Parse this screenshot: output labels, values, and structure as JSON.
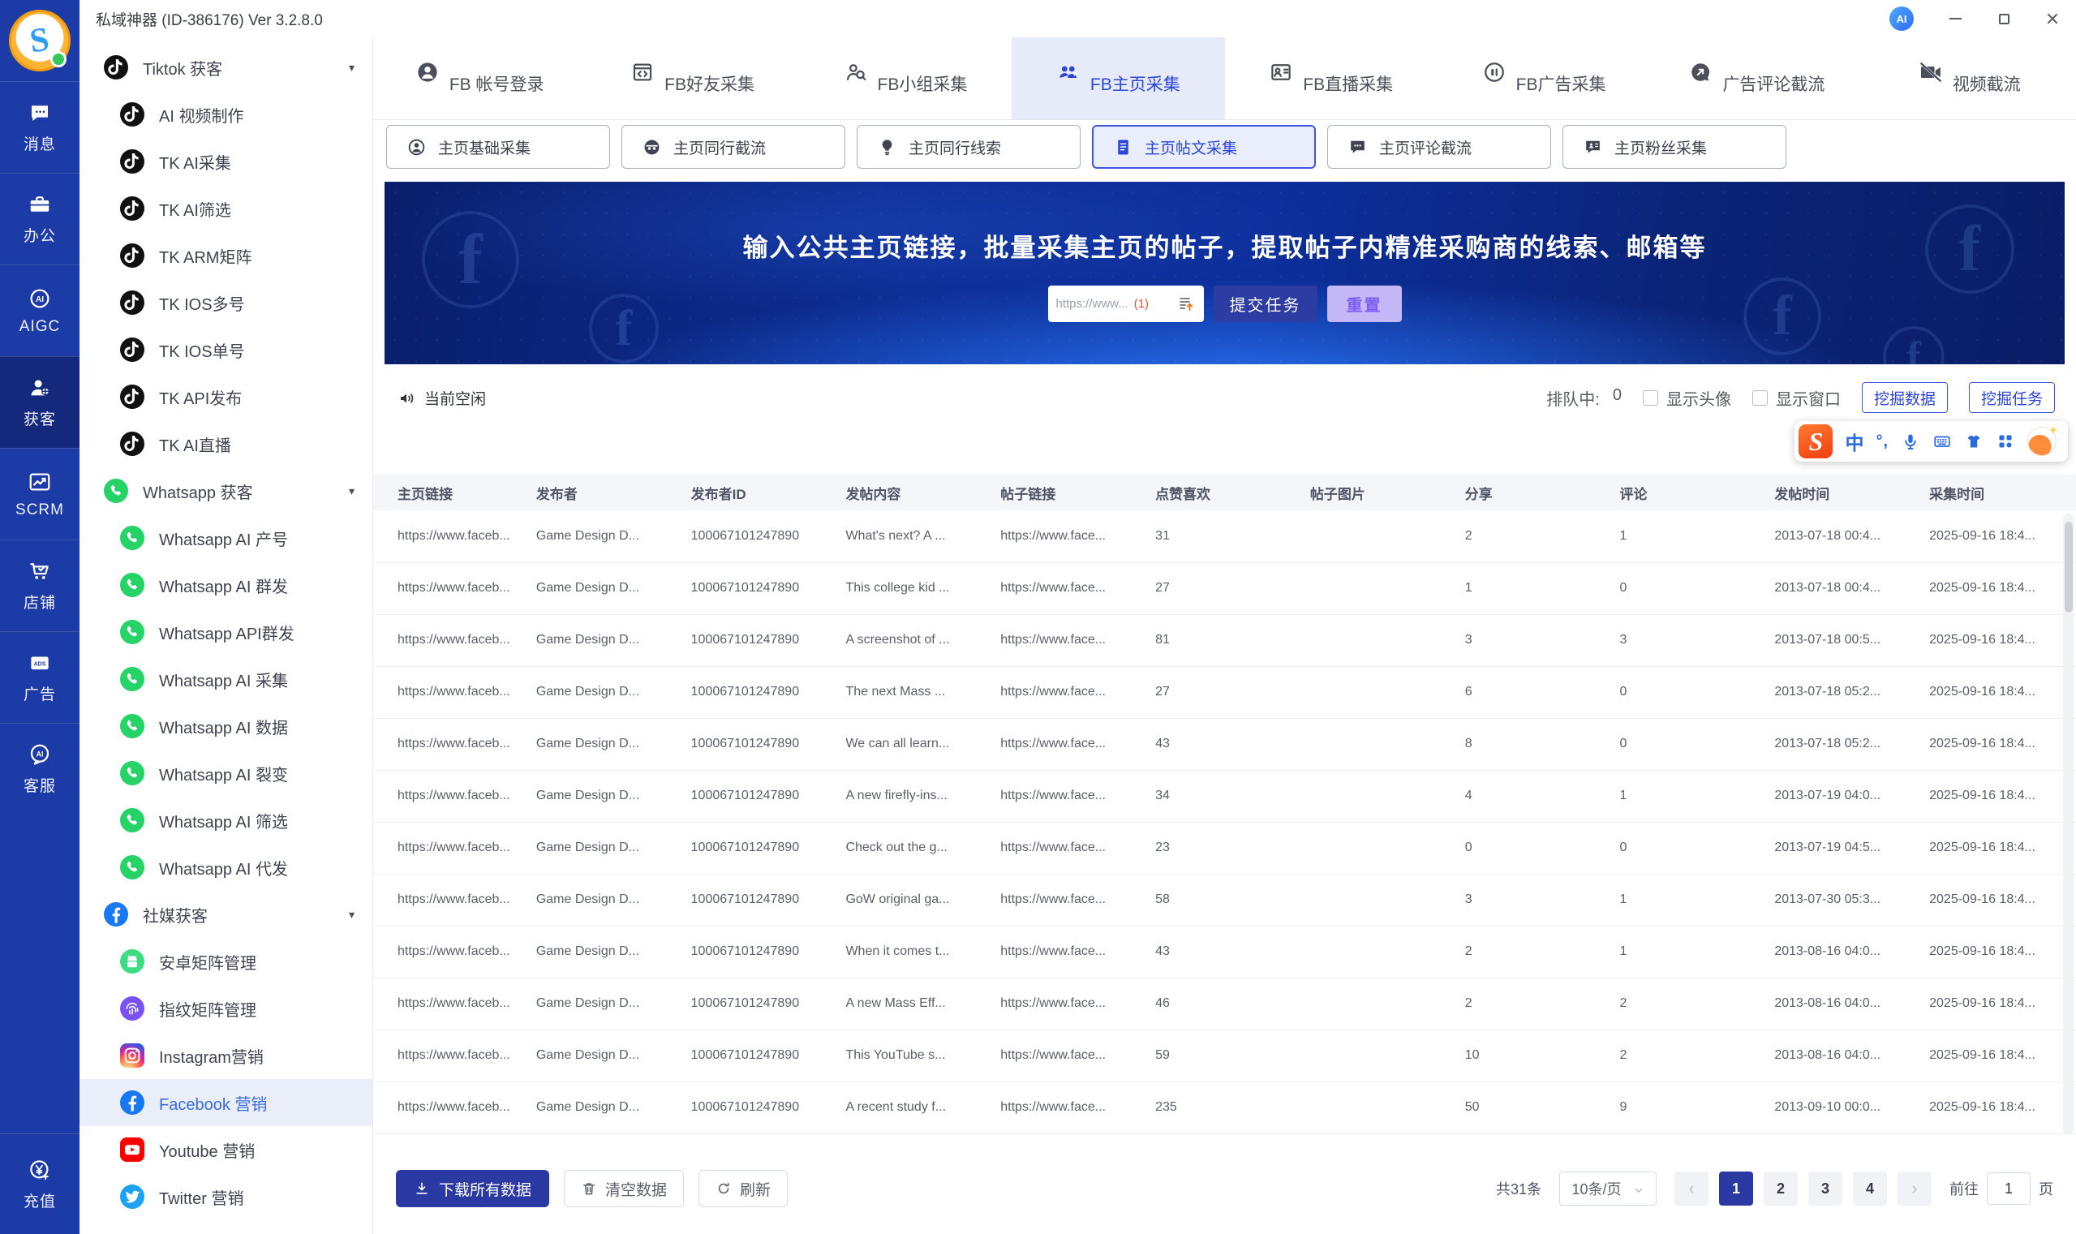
{
  "theme": {
    "primary": "#2c45d6",
    "primary_dark": "#2b3aa3",
    "rail_bg": "#1d3ba6",
    "rail_selected": "#15297c",
    "accent_red": "#f4502e",
    "reset_bg": "#c3b7f6",
    "reset_text": "#7e5ef2",
    "tab_selected_bg": "#e7eaf8",
    "brand": {
      "tiktok": "#111111",
      "whatsapp": "#25d366",
      "facebook": "#1877f2",
      "android": "#3ddc84",
      "fingerprint": "#7a52f4",
      "youtube": "#ff0000",
      "twitter": "#1da1f2",
      "sogou": "#fc5531",
      "instagram": "radial-gradient(circle at 30% 110%, #fdf497 0%, #fd5949 45%, #d6249f 60%, #285aeb 90%)"
    }
  },
  "window": {
    "title": "私域神器 (ID-386176) Ver 3.2.8.0",
    "ai_badge": "AI"
  },
  "rail": {
    "items": [
      {
        "name": "messages",
        "icon": "message-icon",
        "label": "消息",
        "selected": false
      },
      {
        "name": "office",
        "icon": "office-icon",
        "label": "办公",
        "selected": false
      },
      {
        "name": "aigc",
        "icon": "aigc-icon",
        "label": "AIGC",
        "selected": false
      },
      {
        "name": "acquire",
        "icon": "acquire-icon",
        "label": "获客",
        "selected": true
      },
      {
        "name": "scrm",
        "icon": "scrm-icon",
        "label": "SCRM",
        "selected": false
      },
      {
        "name": "shop",
        "icon": "shop-icon",
        "label": "店铺",
        "selected": false
      },
      {
        "name": "ads",
        "icon": "ads-icon",
        "label": "广告",
        "selected": false
      },
      {
        "name": "service",
        "icon": "service-icon",
        "label": "客服",
        "selected": false
      }
    ],
    "bottom": {
      "name": "recharge",
      "icon": "recharge-icon",
      "label": "充值"
    }
  },
  "sidebar": {
    "items": [
      {
        "name": "tiktok-group",
        "type": "group",
        "icon": "tiktok-icon",
        "label": "Tiktok 获客"
      },
      {
        "name": "ai-video",
        "type": "item",
        "icon": "tiktok-icon",
        "label": "AI 视频制作"
      },
      {
        "name": "tk-ai-collect",
        "type": "item",
        "icon": "tiktok-icon",
        "label": "TK AI采集"
      },
      {
        "name": "tk-ai-filter",
        "type": "item",
        "icon": "tiktok-icon",
        "label": "TK AI筛选"
      },
      {
        "name": "tk-arm-matrix",
        "type": "item",
        "icon": "tiktok-icon",
        "label": "TK ARM矩阵"
      },
      {
        "name": "tk-ios-multi",
        "type": "item",
        "icon": "tiktok-icon",
        "label": "TK IOS多号"
      },
      {
        "name": "tk-ios-single",
        "type": "item",
        "icon": "tiktok-icon",
        "label": "TK IOS单号"
      },
      {
        "name": "tk-api-publish",
        "type": "item",
        "icon": "tiktok-icon",
        "label": "TK API发布"
      },
      {
        "name": "tk-ai-live",
        "type": "item",
        "icon": "tiktok-icon",
        "label": "TK AI直播"
      },
      {
        "name": "whatsapp-group",
        "type": "group",
        "icon": "whatsapp-icon",
        "label": "Whatsapp 获客"
      },
      {
        "name": "wa-ai-account",
        "type": "item",
        "icon": "whatsapp-icon",
        "label": "Whatsapp AI 产号"
      },
      {
        "name": "wa-ai-mass",
        "type": "item",
        "icon": "whatsapp-icon",
        "label": "Whatsapp AI 群发"
      },
      {
        "name": "wa-api-mass",
        "type": "item",
        "icon": "whatsapp-icon",
        "label": "Whatsapp API群发"
      },
      {
        "name": "wa-ai-collect",
        "type": "item",
        "icon": "whatsapp-icon",
        "label": "Whatsapp AI 采集"
      },
      {
        "name": "wa-ai-data",
        "type": "item",
        "icon": "whatsapp-icon",
        "label": "Whatsapp AI 数据"
      },
      {
        "name": "wa-ai-fission",
        "type": "item",
        "icon": "whatsapp-icon",
        "label": "Whatsapp AI 裂变"
      },
      {
        "name": "wa-ai-filter",
        "type": "item",
        "icon": "whatsapp-icon",
        "label": "Whatsapp AI 筛选"
      },
      {
        "name": "wa-ai-proxy",
        "type": "item",
        "icon": "whatsapp-icon",
        "label": "Whatsapp AI 代发"
      },
      {
        "name": "social-group",
        "type": "group",
        "icon": "facebook-icon",
        "label": "社媒获客"
      },
      {
        "name": "android-matrix",
        "type": "item",
        "icon": "android-icon",
        "label": "安卓矩阵管理"
      },
      {
        "name": "fingerprint-matrix",
        "type": "item",
        "icon": "fingerprint-icon",
        "label": "指纹矩阵管理"
      },
      {
        "name": "instagram-marketing",
        "type": "item",
        "icon": "instagram-icon",
        "label": "Instagram营销"
      },
      {
        "name": "facebook-marketing",
        "type": "item",
        "icon": "facebook-icon",
        "label": "Facebook 营销",
        "selected": true
      },
      {
        "name": "youtube-marketing",
        "type": "item",
        "icon": "youtube-icon",
        "label": "Youtube 营销"
      },
      {
        "name": "twitter-marketing",
        "type": "item",
        "icon": "twitter-icon",
        "label": "Twitter 营销"
      }
    ]
  },
  "tabs": [
    {
      "name": "fb-login",
      "icon": "account-icon",
      "label": "FB 帐号登录"
    },
    {
      "name": "fb-friends",
      "icon": "friends-icon",
      "label": "FB好友采集"
    },
    {
      "name": "fb-groups",
      "icon": "group-search-icon",
      "label": "FB小组采集"
    },
    {
      "name": "fb-pages",
      "icon": "page-collect-icon",
      "label": "FB主页采集",
      "selected": true
    },
    {
      "name": "fb-live",
      "icon": "live-icon",
      "label": "FB直播采集"
    },
    {
      "name": "fb-ads",
      "icon": "fb-ads-icon",
      "label": "FB广告采集"
    },
    {
      "name": "ad-comment",
      "icon": "ad-comment-icon",
      "label": "广告评论截流"
    },
    {
      "name": "video-intercept",
      "icon": "video-icon",
      "label": "视频截流"
    }
  ],
  "subtabs": [
    {
      "name": "page-basic",
      "icon": "profile-icon",
      "label": "主页基础采集"
    },
    {
      "name": "peer-intercept",
      "icon": "peer-icon",
      "label": "主页同行截流"
    },
    {
      "name": "peer-leads",
      "icon": "bulb-icon",
      "label": "主页同行线索"
    },
    {
      "name": "page-posts",
      "icon": "post-doc-icon",
      "label": "主页帖文采集",
      "selected": true
    },
    {
      "name": "comment-intercept",
      "icon": "comment-icon",
      "label": "主页评论截流"
    },
    {
      "name": "fans-collect",
      "icon": "fans-icon",
      "label": "主页粉丝采集"
    }
  ],
  "banner": {
    "title": "输入公共主页链接，批量采集主页的帖子，提取帖子内精准采购商的线索、邮箱等",
    "input_placeholder": "https://www...",
    "input_count": "(1)",
    "submit_label": "提交任务",
    "reset_label": "重置"
  },
  "statusbar": {
    "idle_label": "当前空闲",
    "queue_label": "排队中:",
    "queue_value": "0",
    "show_avatar": "显示头像",
    "show_window": "显示窗口",
    "mine_data": "挖掘数据",
    "mine_task": "挖掘任务"
  },
  "ime": {
    "logo": "S",
    "mode": "中",
    "punct": "°,"
  },
  "table": {
    "columns": [
      {
        "key": "link",
        "label": "主页链接"
      },
      {
        "key": "publisher",
        "label": "发布者"
      },
      {
        "key": "publisher_id",
        "label": "发布者ID"
      },
      {
        "key": "content",
        "label": "发帖内容"
      },
      {
        "key": "post_link",
        "label": "帖子链接"
      },
      {
        "key": "likes",
        "label": "点赞喜欢"
      },
      {
        "key": "image",
        "label": "帖子图片"
      },
      {
        "key": "shares",
        "label": "分享"
      },
      {
        "key": "comments",
        "label": "评论"
      },
      {
        "key": "post_time",
        "label": "发帖时间"
      },
      {
        "key": "collect_time",
        "label": "采集时间"
      }
    ],
    "rows": [
      {
        "link": "https://www.faceb...",
        "publisher": "Game Design D...",
        "publisher_id": "100067101247890",
        "content": "What's next? A ...",
        "post_link": "https://www.face...",
        "likes": "31",
        "image": "",
        "shares": "2",
        "comments": "1",
        "post_time": "2013-07-18 00:4...",
        "collect_time": "2025-09-16 18:4..."
      },
      {
        "link": "https://www.faceb...",
        "publisher": "Game Design D...",
        "publisher_id": "100067101247890",
        "content": "This college kid ...",
        "post_link": "https://www.face...",
        "likes": "27",
        "image": "",
        "shares": "1",
        "comments": "0",
        "post_time": "2013-07-18 00:4...",
        "collect_time": "2025-09-16 18:4..."
      },
      {
        "link": "https://www.faceb...",
        "publisher": "Game Design D...",
        "publisher_id": "100067101247890",
        "content": "A screenshot of ...",
        "post_link": "https://www.face...",
        "likes": "81",
        "image": "",
        "shares": "3",
        "comments": "3",
        "post_time": "2013-07-18 00:5...",
        "collect_time": "2025-09-16 18:4..."
      },
      {
        "link": "https://www.faceb...",
        "publisher": "Game Design D...",
        "publisher_id": "100067101247890",
        "content": "The next Mass ...",
        "post_link": "https://www.face...",
        "likes": "27",
        "image": "",
        "shares": "6",
        "comments": "0",
        "post_time": "2013-07-18 05:2...",
        "collect_time": "2025-09-16 18:4..."
      },
      {
        "link": "https://www.faceb...",
        "publisher": "Game Design D...",
        "publisher_id": "100067101247890",
        "content": "We can all learn...",
        "post_link": "https://www.face...",
        "likes": "43",
        "image": "",
        "shares": "8",
        "comments": "0",
        "post_time": "2013-07-18 05:2...",
        "collect_time": "2025-09-16 18:4..."
      },
      {
        "link": "https://www.faceb...",
        "publisher": "Game Design D...",
        "publisher_id": "100067101247890",
        "content": "A new firefly-ins...",
        "post_link": "https://www.face...",
        "likes": "34",
        "image": "",
        "shares": "4",
        "comments": "1",
        "post_time": "2013-07-19 04:0...",
        "collect_time": "2025-09-16 18:4..."
      },
      {
        "link": "https://www.faceb...",
        "publisher": "Game Design D...",
        "publisher_id": "100067101247890",
        "content": "Check out the g...",
        "post_link": "https://www.face...",
        "likes": "23",
        "image": "",
        "shares": "0",
        "comments": "0",
        "post_time": "2013-07-19 04:5...",
        "collect_time": "2025-09-16 18:4..."
      },
      {
        "link": "https://www.faceb...",
        "publisher": "Game Design D...",
        "publisher_id": "100067101247890",
        "content": "GoW original ga...",
        "post_link": "https://www.face...",
        "likes": "58",
        "image": "",
        "shares": "3",
        "comments": "1",
        "post_time": "2013-07-30 05:3...",
        "collect_time": "2025-09-16 18:4..."
      },
      {
        "link": "https://www.faceb...",
        "publisher": "Game Design D...",
        "publisher_id": "100067101247890",
        "content": "When it comes t...",
        "post_link": "https://www.face...",
        "likes": "43",
        "image": "",
        "shares": "2",
        "comments": "1",
        "post_time": "2013-08-16 04:0...",
        "collect_time": "2025-09-16 18:4..."
      },
      {
        "link": "https://www.faceb...",
        "publisher": "Game Design D...",
        "publisher_id": "100067101247890",
        "content": "A new Mass Eff...",
        "post_link": "https://www.face...",
        "likes": "46",
        "image": "",
        "shares": "2",
        "comments": "2",
        "post_time": "2013-08-16 04:0...",
        "collect_time": "2025-09-16 18:4..."
      },
      {
        "link": "https://www.faceb...",
        "publisher": "Game Design D...",
        "publisher_id": "100067101247890",
        "content": "This YouTube s...",
        "post_link": "https://www.face...",
        "likes": "59",
        "image": "",
        "shares": "10",
        "comments": "2",
        "post_time": "2013-08-16 04:0...",
        "collect_time": "2025-09-16 18:4..."
      },
      {
        "link": "https://www.faceb...",
        "publisher": "Game Design D...",
        "publisher_id": "100067101247890",
        "content": "A recent study f...",
        "post_link": "https://www.face...",
        "likes": "235",
        "image": "",
        "shares": "50",
        "comments": "9",
        "post_time": "2013-09-10 00:0...",
        "collect_time": "2025-09-16 18:4..."
      }
    ]
  },
  "footer": {
    "download_label": "下载所有数据",
    "clear_label": "清空数据",
    "refresh_label": "刷新",
    "total_label": "共31条",
    "page_size": "10条/页",
    "prev": "‹",
    "next": "›",
    "pages": [
      "1",
      "2",
      "3",
      "4"
    ],
    "active_page": "1",
    "goto_label": "前往",
    "goto_value": "1",
    "goto_suffix": "页"
  }
}
